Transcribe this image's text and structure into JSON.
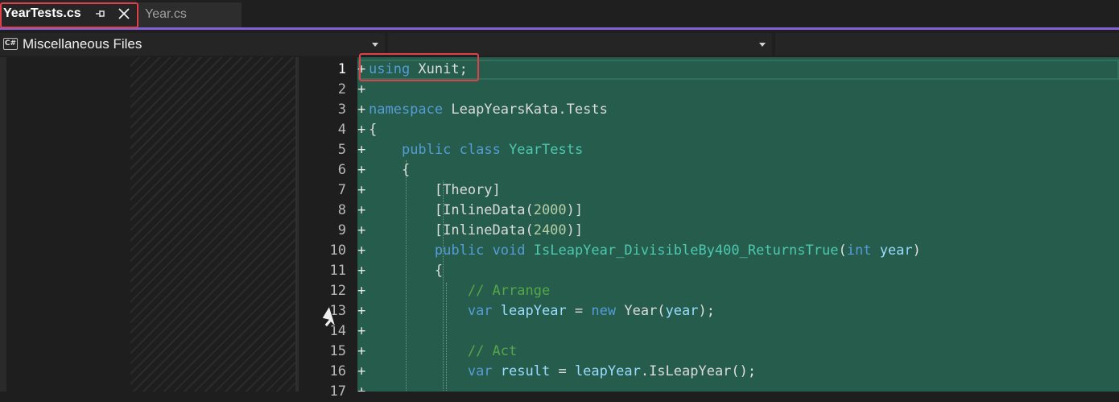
{
  "tabs": {
    "active": {
      "label": "YearTests.cs"
    },
    "inactive": {
      "label": "Year.cs"
    }
  },
  "navbar": {
    "project_icon_text": "C#",
    "project_label": "Miscellaneous Files",
    "type_label": "",
    "member_label": ""
  },
  "editor": {
    "line_numbers": [
      "1",
      "2",
      "3",
      "4",
      "5",
      "6",
      "7",
      "8",
      "9",
      "10",
      "11",
      "12",
      "13",
      "14",
      "15",
      "16",
      "17"
    ],
    "current_line": 1,
    "added_marker": "+"
  },
  "colors": {
    "accent": "#8460d8",
    "added_background": "#255c4b",
    "keyword": "#569cd6",
    "type": "#4ec9b0",
    "number": "#b5cea8",
    "comment": "#57a64a",
    "parameter": "#9cdcfe",
    "highlight_box": "#e0404a"
  },
  "icons": [
    "pin-icon",
    "close-icon",
    "csharp-file-icon",
    "chevron-down-icon",
    "mouse-cursor-icon"
  ]
}
